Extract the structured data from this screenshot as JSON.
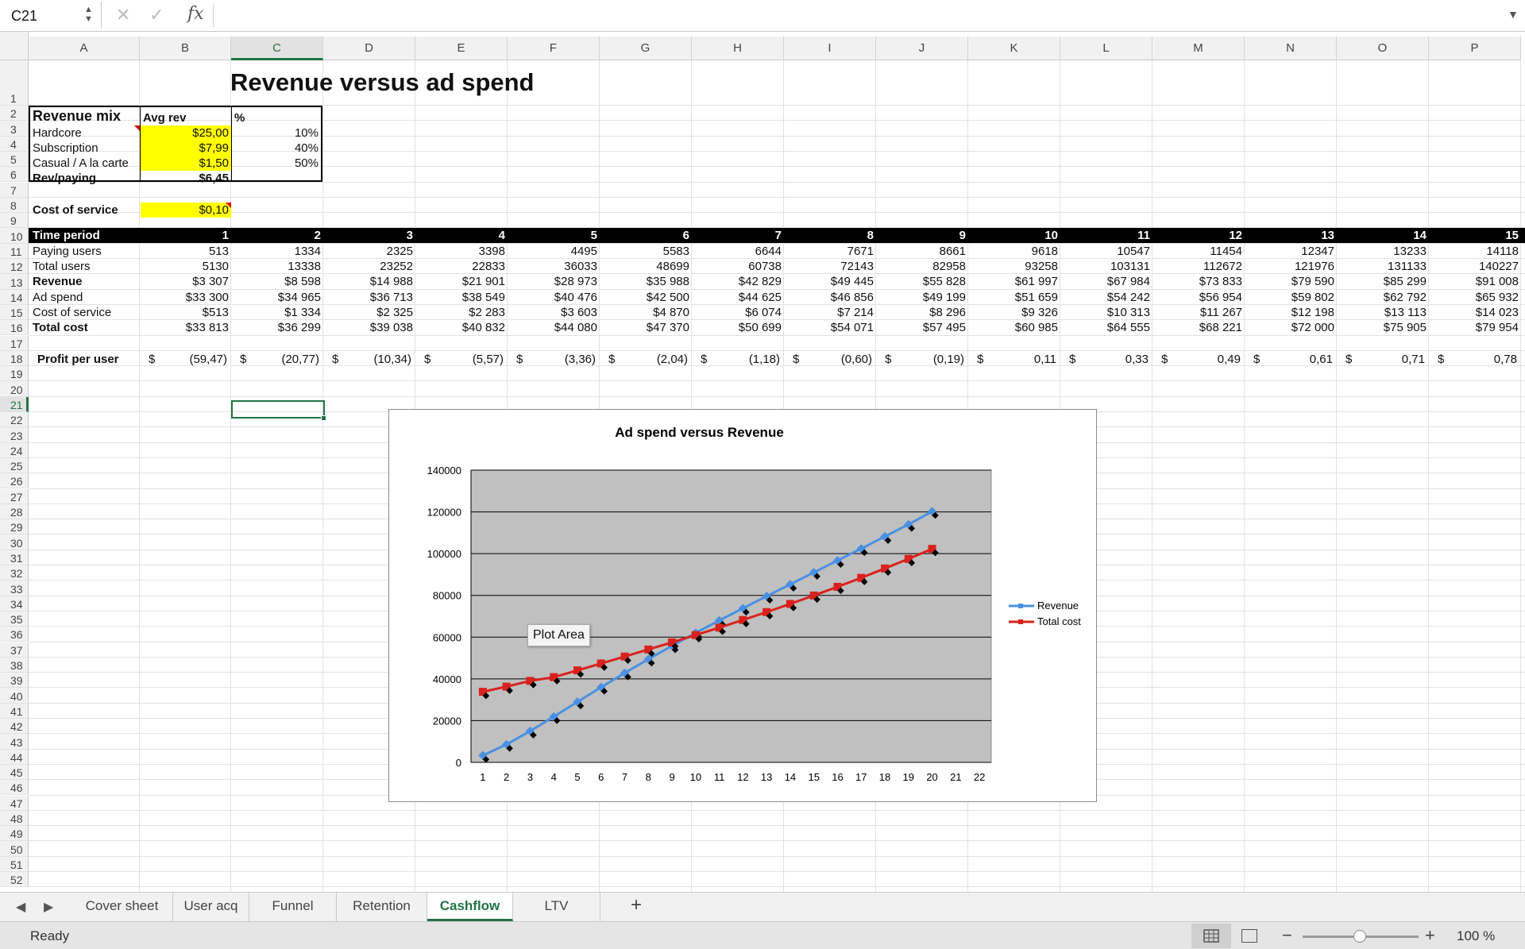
{
  "formula_bar": {
    "name_box": "C21",
    "cancel_icon": "x-icon",
    "confirm_icon": "check-icon",
    "fx_label": "fx",
    "formula_value": ""
  },
  "columns": [
    "A",
    "B",
    "C",
    "D",
    "E",
    "F",
    "G",
    "H",
    "I",
    "J",
    "K",
    "L",
    "M",
    "N",
    "O",
    "P"
  ],
  "selected_column": "C",
  "row_numbers": [
    "1",
    "2",
    "3",
    "4",
    "5",
    "6",
    "7",
    "8",
    "9",
    "10",
    "11",
    "12",
    "13",
    "14",
    "15",
    "16",
    "17",
    "18",
    "19",
    "20",
    "21",
    "22",
    "23",
    "24",
    "25",
    "26",
    "27",
    "28",
    "29",
    "30",
    "31",
    "32",
    "33",
    "34",
    "35",
    "36",
    "37",
    "38",
    "39",
    "40",
    "41",
    "42",
    "43",
    "44",
    "45",
    "46",
    "47",
    "48",
    "49",
    "50",
    "51",
    "52"
  ],
  "selected_row": "21",
  "sheet": {
    "title": "Revenue versus ad spend",
    "revenue_mix": {
      "header": [
        "Revenue mix",
        "Avg rev",
        "%"
      ],
      "rows": [
        [
          "Hardcore",
          "$25,00",
          "10%"
        ],
        [
          "Subscription",
          "$7,99",
          "40%"
        ],
        [
          "Casual / A la carte",
          "$1,50",
          "50%"
        ]
      ],
      "rev_paying_label": "Rev/paying",
      "rev_paying_value": "$6,45"
    },
    "cost_of_service_label": "Cost of service",
    "cost_of_service_value": "$0,10",
    "table": {
      "header_label": "Time period",
      "periods": [
        "1",
        "2",
        "3",
        "4",
        "5",
        "6",
        "7",
        "8",
        "9",
        "10",
        "11",
        "12",
        "13",
        "14",
        "15"
      ],
      "rows": [
        {
          "label": "Paying users",
          "bold": false,
          "values": [
            "513",
            "1334",
            "2325",
            "3398",
            "4495",
            "5583",
            "6644",
            "7671",
            "8661",
            "9618",
            "10547",
            "11454",
            "12347",
            "13233",
            "14118"
          ]
        },
        {
          "label": "Total users",
          "bold": false,
          "values": [
            "5130",
            "13338",
            "23252",
            "22833",
            "36033",
            "48699",
            "60738",
            "72143",
            "82958",
            "93258",
            "103131",
            "112672",
            "121976",
            "131133",
            "140227"
          ]
        },
        {
          "label": "Revenue",
          "bold": true,
          "values": [
            "$3 307",
            "$8 598",
            "$14 988",
            "$21 901",
            "$28 973",
            "$35 988",
            "$42 829",
            "$49 445",
            "$55 828",
            "$61 997",
            "$67 984",
            "$73 833",
            "$79 590",
            "$85 299",
            "$91 008"
          ]
        },
        {
          "label": "Ad spend",
          "bold": false,
          "values": [
            "$33 300",
            "$34 965",
            "$36 713",
            "$38 549",
            "$40 476",
            "$42 500",
            "$44 625",
            "$46 856",
            "$49 199",
            "$51 659",
            "$54 242",
            "$56 954",
            "$59 802",
            "$62 792",
            "$65 932"
          ]
        },
        {
          "label": "Cost of service",
          "bold": false,
          "values": [
            "$513",
            "$1 334",
            "$2 325",
            "$2 283",
            "$3 603",
            "$4 870",
            "$6 074",
            "$7 214",
            "$8 296",
            "$9 326",
            "$10 313",
            "$11 267",
            "$12 198",
            "$13 113",
            "$14 023"
          ]
        },
        {
          "label": "Total cost",
          "bold": true,
          "values": [
            "$33 813",
            "$36 299",
            "$39 038",
            "$40 832",
            "$44 080",
            "$47 370",
            "$50 699",
            "$54 071",
            "$57 495",
            "$60 985",
            "$64 555",
            "$68 221",
            "$72 000",
            "$75 905",
            "$79 954"
          ]
        }
      ],
      "profit_label": "Profit per user",
      "currency_symbol": "$",
      "profit_values": [
        "(59,47)",
        "(20,77)",
        "(10,34)",
        "(5,57)",
        "(3,36)",
        "(2,04)",
        "(1,18)",
        "(0,60)",
        "(0,19)",
        "0,11",
        "0,33",
        "0,49",
        "0,61",
        "0,71",
        "0,78"
      ]
    }
  },
  "chart_data": {
    "type": "line",
    "title": "Ad spend versus Revenue",
    "x": [
      1,
      2,
      3,
      4,
      5,
      6,
      7,
      8,
      9,
      10,
      11,
      12,
      13,
      14,
      15,
      16,
      17,
      18,
      19,
      20
    ],
    "x_ticks": [
      "1",
      "2",
      "3",
      "4",
      "5",
      "6",
      "7",
      "8",
      "9",
      "10",
      "11",
      "12",
      "13",
      "14",
      "15",
      "16",
      "17",
      "18",
      "19",
      "20",
      "21",
      "22"
    ],
    "ylim": [
      0,
      140000
    ],
    "y_ticks": [
      "0",
      "20000",
      "40000",
      "60000",
      "80000",
      "100000",
      "120000",
      "140000"
    ],
    "grid": true,
    "legend_placement": "right",
    "series": [
      {
        "name": "Revenue",
        "color": "#4a90e2",
        "values": [
          3307,
          8598,
          14988,
          21901,
          28973,
          35988,
          42829,
          49445,
          55828,
          61997,
          67984,
          73833,
          79590,
          85299,
          91008,
          96700,
          102400,
          108200,
          114000,
          120200
        ]
      },
      {
        "name": "Total cost",
        "color": "#d9221d",
        "values": [
          33813,
          36299,
          39038,
          40832,
          44080,
          47370,
          50699,
          54071,
          57495,
          60985,
          64555,
          68221,
          72000,
          75905,
          79954,
          84100,
          88400,
          92900,
          97500,
          102300
        ]
      }
    ],
    "trendline_color": "#000000",
    "plot_background": "#c0c0c0",
    "tooltip": "Plot Area"
  },
  "tabs": [
    "Cover sheet",
    "User acq",
    "Funnel",
    "Retention",
    "Cashflow",
    "LTV"
  ],
  "active_tab": "Cashflow",
  "status": {
    "text": "Ready",
    "zoom": "100 %"
  },
  "colors": {
    "accent": "#217346",
    "highlight": "#ffff00"
  }
}
